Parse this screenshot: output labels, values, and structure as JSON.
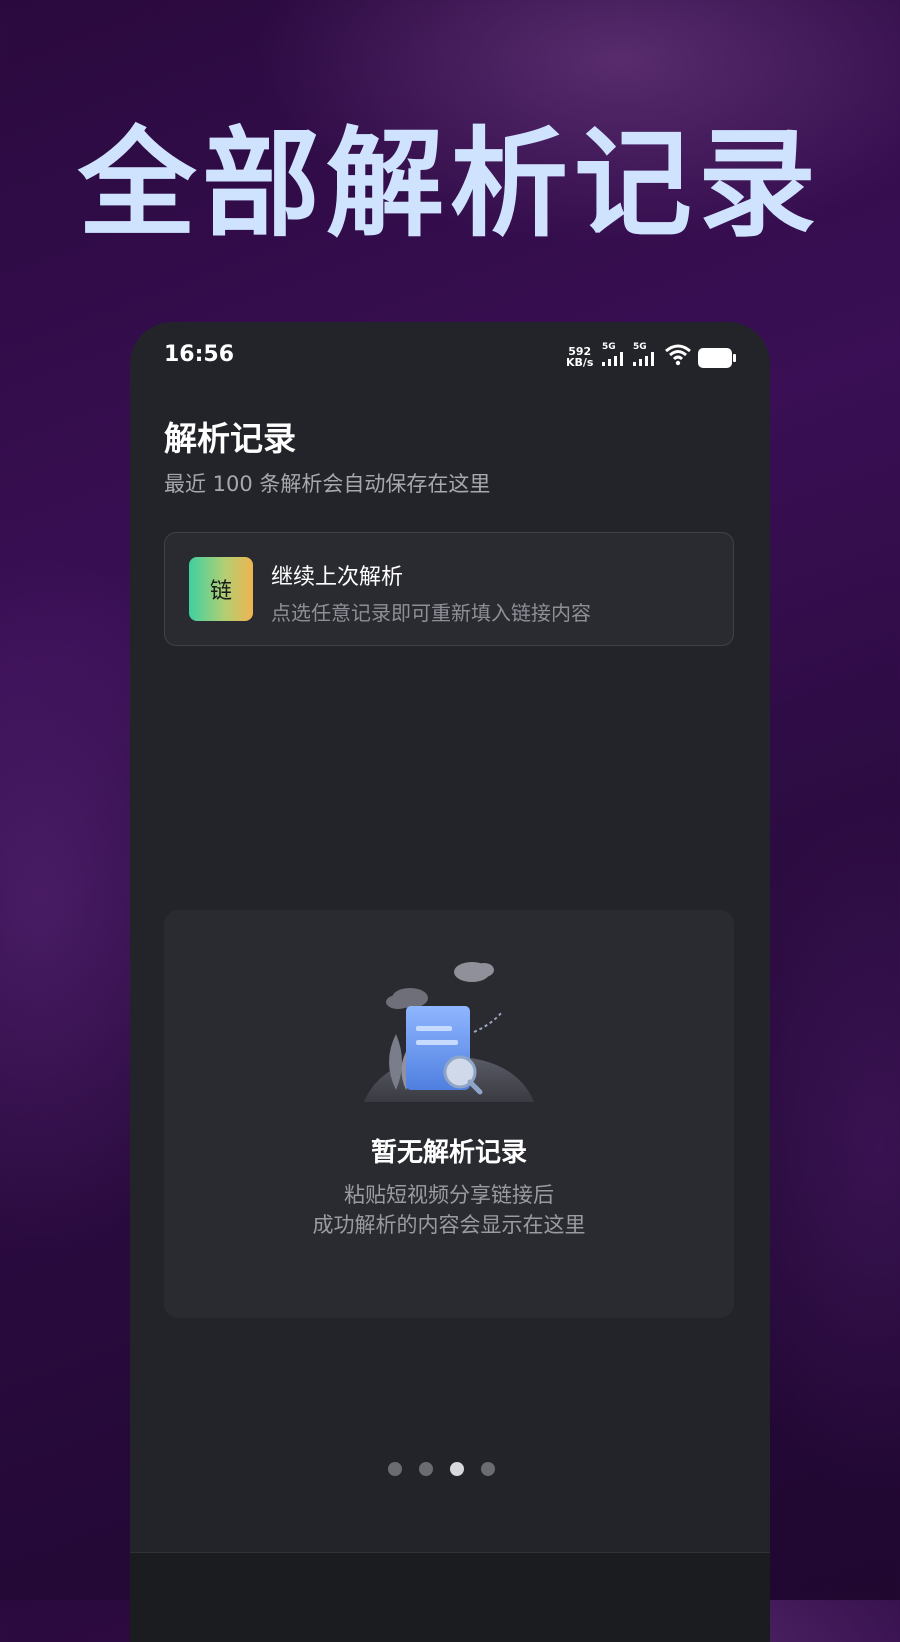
{
  "banner": {
    "title": "全部解析记录"
  },
  "status_bar": {
    "time": "16:56",
    "net_speed_value": "592",
    "net_speed_unit": "KB/s",
    "signal1_label": "5G",
    "signal2_label": "5G",
    "wifi_icon": "wifi-icon",
    "battery_icon": "battery-icon"
  },
  "page": {
    "title": "解析记录",
    "subtitle": "最近 100 条解析会自动保存在这里"
  },
  "continue_card": {
    "badge": "链",
    "title": "继续上次解析",
    "subtitle": "点选任意记录即可重新填入链接内容"
  },
  "empty_state": {
    "title": "暂无解析记录",
    "line1": "粘贴短视频分享链接后",
    "line2": "成功解析的内容会显示在这里"
  },
  "pagination": {
    "total": 4,
    "active_index": 2
  },
  "colors": {
    "background": "#2a0a3e",
    "banner_text": "#cfe3ff",
    "phone_bg": "#232429",
    "card_bg": "#2a2b31"
  }
}
